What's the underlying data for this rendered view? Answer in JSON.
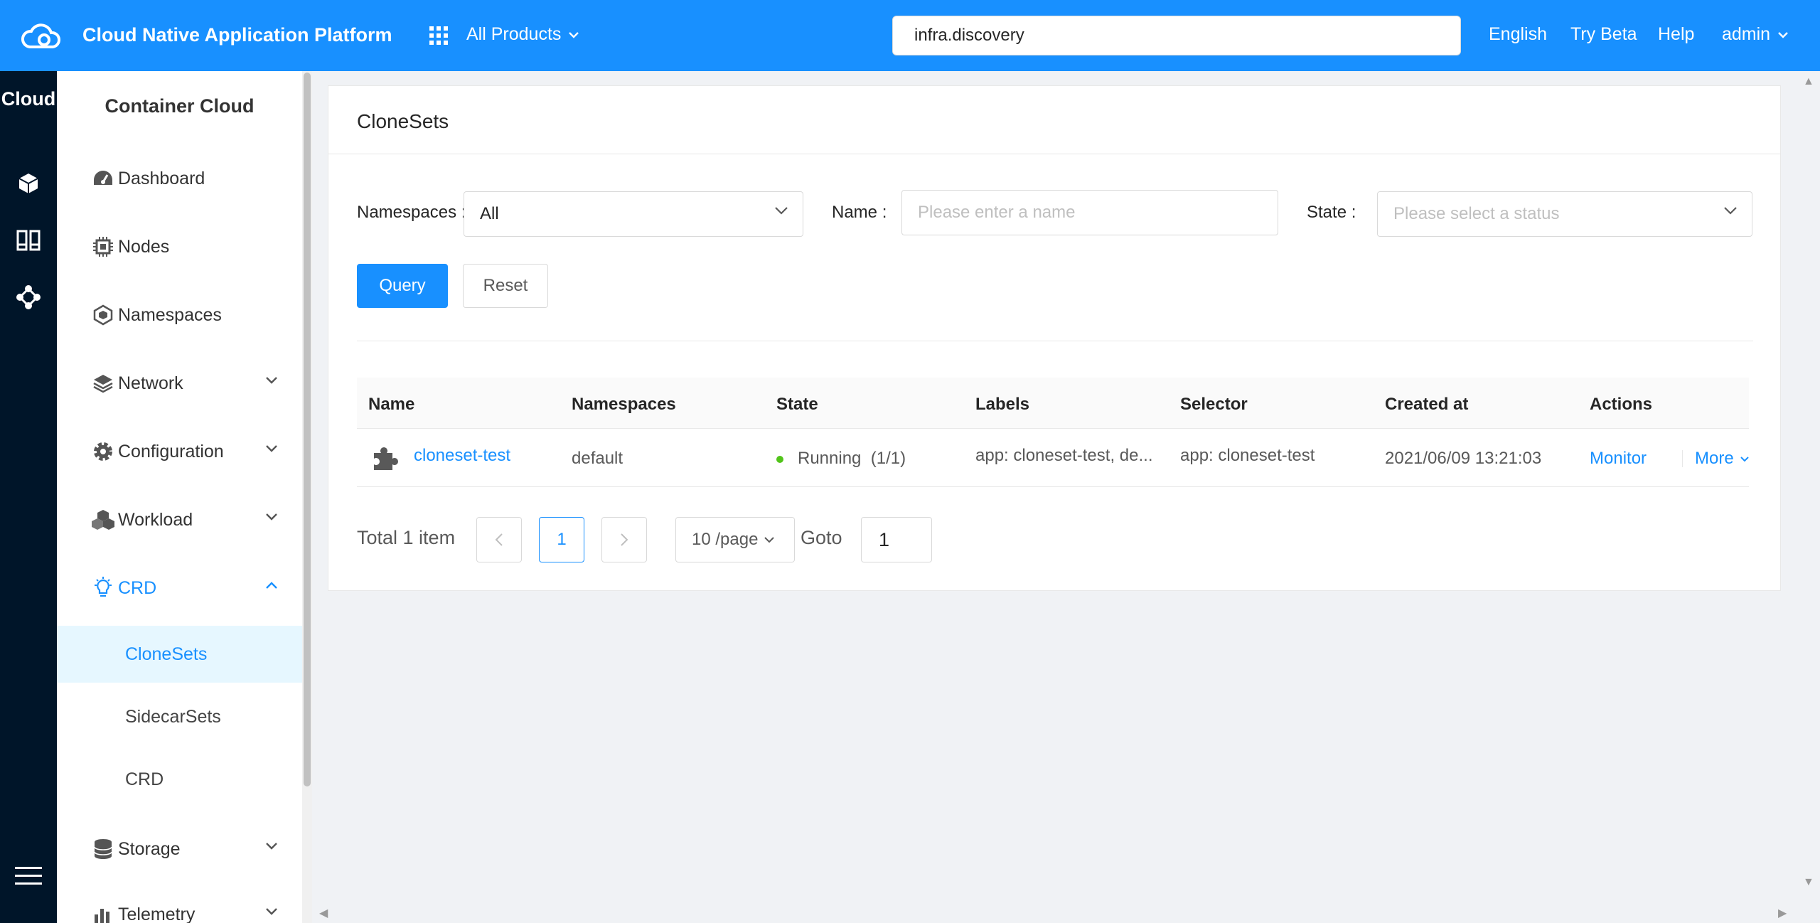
{
  "topbar": {
    "brand": "Cloud Native Application Platform",
    "products": "All Products",
    "search_value": "infra.discovery",
    "language": "English",
    "try_beta": "Try Beta",
    "help": "Help",
    "user": "admin"
  },
  "rail": {
    "title": "Cloud",
    "icons": [
      "cube-icon",
      "columns-icon",
      "cluster-icon",
      "menu-icon"
    ]
  },
  "sidebar": {
    "title": "Container Cloud",
    "items": [
      {
        "label": "Dashboard",
        "icon": "dashboard-icon"
      },
      {
        "label": "Nodes",
        "icon": "chip-icon"
      },
      {
        "label": "Namespaces",
        "icon": "hexagon-icon"
      },
      {
        "label": "Network",
        "icon": "layers-icon"
      },
      {
        "label": "Configuration",
        "icon": "gear-icon"
      },
      {
        "label": "Workload",
        "icon": "cubes-icon"
      },
      {
        "label": "CRD",
        "icon": "bulb-icon"
      },
      {
        "label": "Storage",
        "icon": "database-icon"
      },
      {
        "label": "Telemetry",
        "icon": "bar-chart-icon"
      }
    ],
    "crd_children": [
      "CloneSets",
      "SidecarSets",
      "CRD"
    ],
    "active": "CloneSets"
  },
  "page": {
    "title": "CloneSets",
    "filters": {
      "namespaces_label": "Namespaces",
      "namespaces_value": "All",
      "name_label": "Name",
      "name_placeholder": "Please enter a name",
      "state_label": "State",
      "state_placeholder": "Please select a status"
    },
    "query_label": "Query",
    "reset_label": "Reset",
    "table": {
      "columns": [
        "Name",
        "Namespaces",
        "State",
        "Labels",
        "Selector",
        "Created at",
        "Actions"
      ],
      "rows": [
        {
          "name": "cloneset-test",
          "namespace": "default",
          "state": "Running",
          "replicas": "(1/1)",
          "labels": "app: cloneset-test, de...",
          "selector": "app: cloneset-test",
          "created_at": "2021/06/09 13:21:03",
          "action_monitor": "Monitor",
          "action_more": "More"
        }
      ]
    },
    "pagination": {
      "total": "Total 1 item",
      "current": "1",
      "page_size": "10 /page",
      "goto_label": "Goto",
      "goto_value": "1"
    }
  },
  "colors": {
    "primary": "#1890ff",
    "rail": "#001529",
    "running": "#52c41a"
  }
}
